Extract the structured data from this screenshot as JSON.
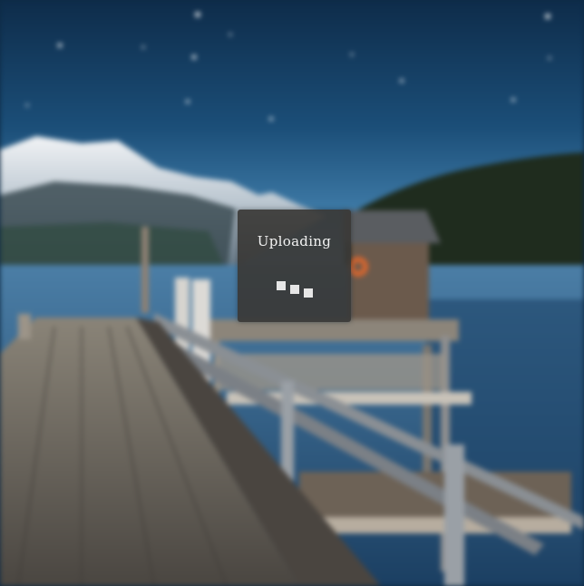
{
  "upload_dialog": {
    "status_text": "Uploading",
    "spinner_icon": "loading-squares-icon",
    "background_color": "#3a3836",
    "text_color": "#f3f3f3"
  },
  "background": {
    "theme_colors": {
      "sky": "#1b4e78",
      "lake": "#2b5c86",
      "mountain": "#c9d2d9",
      "dock": "#6d6760"
    }
  }
}
